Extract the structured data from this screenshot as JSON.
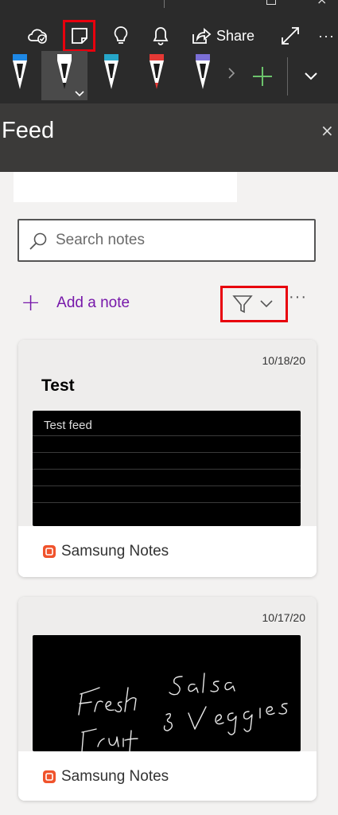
{
  "toolbar": {
    "share_label": "Share",
    "more_label": "···",
    "pens": [
      {
        "name": "pen-black-blue-band",
        "tip": "#1a1a1a",
        "band": "#1e88e5"
      },
      {
        "name": "pen-white-selected",
        "tip": "#1a1a1a",
        "band": "#ffffff"
      },
      {
        "name": "pen-black-teal-band",
        "tip": "#1a1a1a",
        "band": "#26a6c9"
      },
      {
        "name": "pen-red",
        "tip": "#e53935",
        "band": "#e53935"
      },
      {
        "name": "pen-galaxy",
        "tip": "#1a1a1a",
        "band": "#7b6fd6"
      }
    ]
  },
  "feed": {
    "title": "Feed",
    "close_label": "×"
  },
  "search": {
    "placeholder": "Search notes"
  },
  "actions": {
    "add_note_label": "Add a note",
    "more_label": "···"
  },
  "notes": [
    {
      "date": "10/18/20",
      "title": "Test",
      "thumbnail_text": "Test feed",
      "source": "Samsung Notes"
    },
    {
      "date": "10/17/20",
      "title": "",
      "thumbnail_handwriting": "Fresh Salsa Fruit & Veggies",
      "source": "Samsung Notes"
    }
  ],
  "colors": {
    "accent": "#7719aa",
    "highlight_box": "#e8000d",
    "toolbar_bg": "#2b2b2b",
    "header_bg": "#3b3a39",
    "samsung_icon": "#f0532c"
  }
}
